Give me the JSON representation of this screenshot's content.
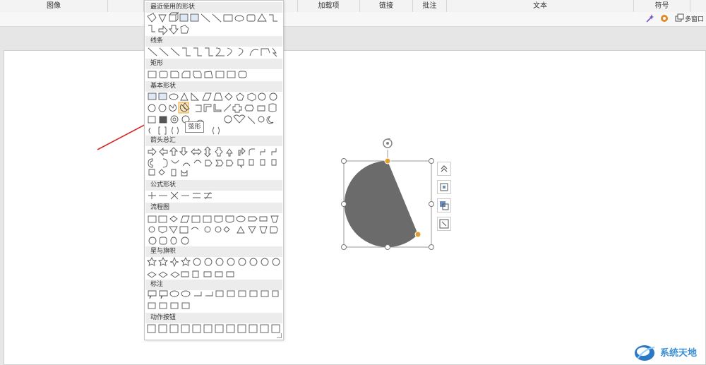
{
  "ribbon_groups": [
    "图像",
    "加载项",
    "链接",
    "批注",
    "文本",
    "符号"
  ],
  "toolbar": {
    "multi_window_label": "多窗口"
  },
  "gallery": {
    "sections": [
      {
        "title": "最近使用的形状"
      },
      {
        "title": "线条"
      },
      {
        "title": "矩形"
      },
      {
        "title": "基本形状"
      },
      {
        "title": "箭头总汇"
      },
      {
        "title": "公式形状"
      },
      {
        "title": "流程图"
      },
      {
        "title": "星与旗帜"
      },
      {
        "title": "标注"
      },
      {
        "title": "动作按钮"
      }
    ],
    "tooltip": "弦形"
  },
  "canvas": {
    "shape_name": "chord-shape",
    "shape_fill": "#6b6b6b",
    "handle_color": "#e0a030"
  },
  "watermark": {
    "text": "系统天地"
  },
  "colors": {
    "arrow": "#d42a2a",
    "accent": "#3a8ed6"
  }
}
